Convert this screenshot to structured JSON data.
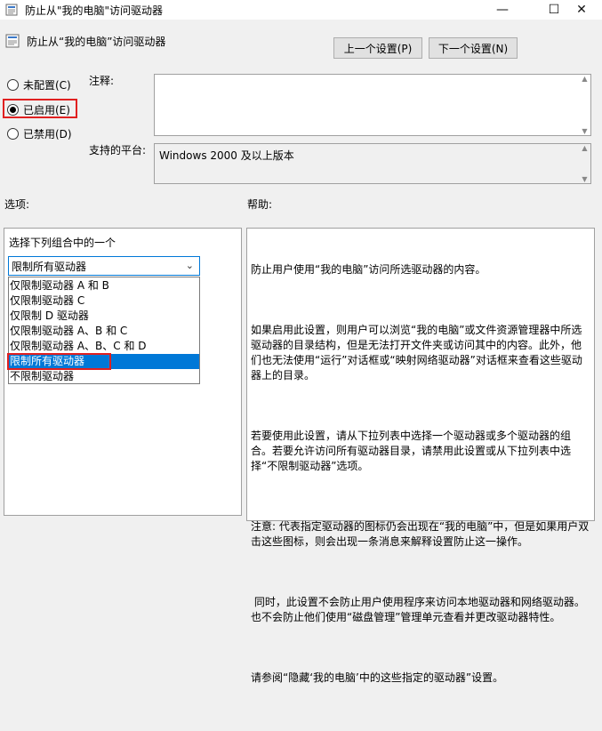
{
  "window": {
    "title": "防止从\"我的电脑\"访问驱动器",
    "minimize": "—",
    "maximize": "☐",
    "close": "✕"
  },
  "header": {
    "title": "防止从“我的电脑”访问驱动器",
    "prev_button": "上一个设置(P)",
    "next_button": "下一个设置(N)"
  },
  "state": {
    "not_configured": "未配置(C)",
    "enabled": "已启用(E)",
    "disabled": "已禁用(D)",
    "selected": "enabled"
  },
  "comment": {
    "label": "注释:",
    "value": ""
  },
  "platform": {
    "label": "支持的平台:",
    "value": "Windows 2000 及以上版本"
  },
  "options": {
    "label": "选项:",
    "prompt": "选择下列组合中的一个",
    "selected_value": "限制所有驱动器",
    "items": [
      "仅限制驱动器 A 和 B",
      "仅限制驱动器 C",
      "仅限制 D 驱动器",
      "仅限制驱动器 A、B 和 C",
      "仅限制驱动器 A、B、C 和 D",
      "限制所有驱动器",
      "不限制驱动器"
    ]
  },
  "help": {
    "label": "帮助:",
    "paragraphs": [
      "防止用户使用“我的电脑”访问所选驱动器的内容。",
      "如果启用此设置，则用户可以浏览“我的电脑”或文件资源管理器中所选驱动器的目录结构，但是无法打开文件夹或访问其中的内容。此外，他们也无法使用“运行”对话框或“映射网络驱动器”对话框来查看这些驱动器上的目录。",
      "若要使用此设置，请从下拉列表中选择一个驱动器或多个驱动器的组合。若要允许访问所有驱动器目录，请禁用此设置或从下拉列表中选择“不限制驱动器”选项。",
      "注意: 代表指定驱动器的图标仍会出现在“我的电脑”中，但是如果用户双击这些图标，则会出现一条消息来解释设置防止这一操作。",
      " 同时，此设置不会防止用户使用程序来访问本地驱动器和网络驱动器。也不会防止他们使用“磁盘管理”管理单元查看并更改驱动器特性。",
      "请参阅“隐藏‘我的电脑’中的这些指定的驱动器”设置。"
    ]
  }
}
